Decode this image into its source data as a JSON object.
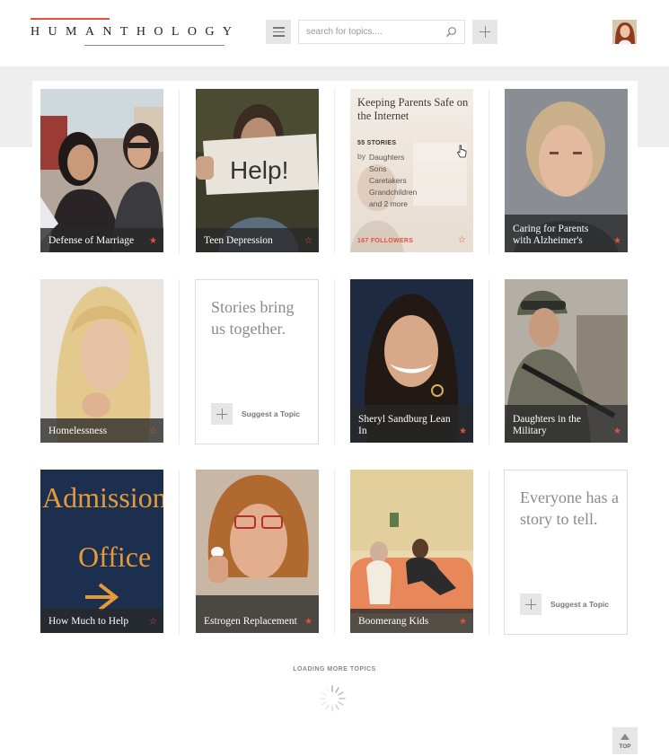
{
  "header": {
    "logo": "HUMANTHOLOGY",
    "search_placeholder": "search for topics....",
    "icons": {
      "menu": "hamburger-icon",
      "search": "search-icon",
      "add": "plus-icon"
    }
  },
  "cards": [
    {
      "title": "Defense of Marriage",
      "starred": true
    },
    {
      "title": "Teen Depression",
      "starred": false
    },
    {
      "title": "Caring for Parents with Alzheimer's",
      "starred": true
    },
    {
      "title": "Homelessness",
      "starred": false
    },
    {
      "title": "Sheryl Sandburg Lean In",
      "starred": true
    },
    {
      "title": "Daughters in the Military",
      "starred": true
    },
    {
      "title": "How Much to Help",
      "starred": false
    },
    {
      "title": "Estrogen Replacement",
      "starred": true
    },
    {
      "title": "Boomerang Kids",
      "starred": true
    }
  ],
  "photo_text": {
    "help_sign": "Help!",
    "admissions_1": "Admissions",
    "admissions_2": "Office"
  },
  "featured": {
    "title": "Keeping Parents Safe on the Internet",
    "stories": "55 STORIES",
    "by": "by",
    "tags": [
      "Daughters",
      "Sons",
      "Caretakers",
      "Grandchildren",
      "and 2 more"
    ],
    "followers": "167 FOLLOWERS"
  },
  "prompts": [
    {
      "text": "Stories bring us together.",
      "button": "Suggest a Topic"
    },
    {
      "text": "Everyone has a story to tell.",
      "button": "Suggest a Topic"
    }
  ],
  "loading": "LOADING MORE TOPICS",
  "top_button": "TOP",
  "colors": {
    "accent": "#e4503c",
    "caption_bg": "#282828",
    "band": "#eeeeee"
  }
}
